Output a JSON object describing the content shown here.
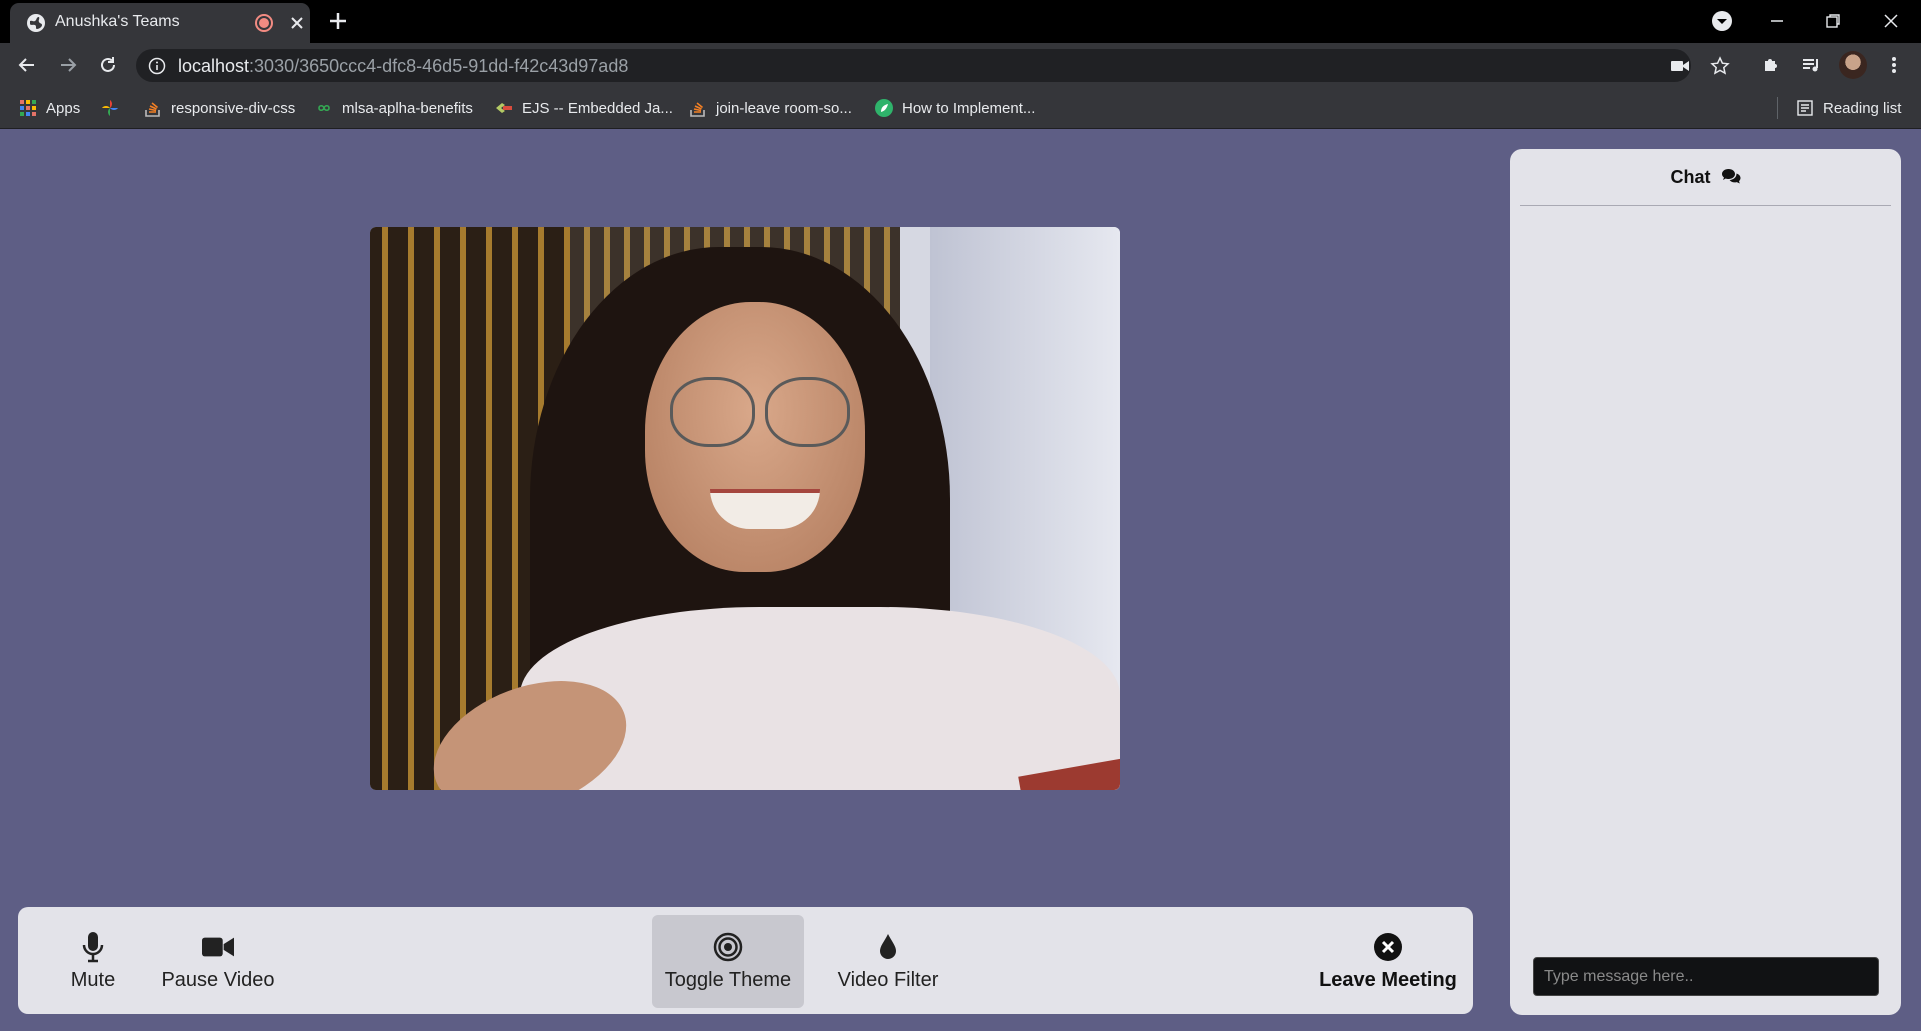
{
  "browser": {
    "tab": {
      "title": "Anushka's Teams"
    },
    "url": {
      "host": "localhost",
      "path": ":3030/3650ccc4-dfc8-46d5-91dd-f42c43d97ad8"
    },
    "bookmarks": [
      {
        "label": "Apps",
        "icon": "apps-grid-icon"
      },
      {
        "label": "",
        "icon": "pinwheel-icon"
      },
      {
        "label": "responsive-div-css",
        "icon": "stackoverflow-icon"
      },
      {
        "label": "mlsa-aplha-benefits",
        "icon": "infinity-icon"
      },
      {
        "label": "EJS -- Embedded Ja...",
        "icon": "ejs-icon"
      },
      {
        "label": "join-leave room-so...",
        "icon": "stackoverflow-icon"
      },
      {
        "label": "How to Implement...",
        "icon": "green-leaf-icon"
      }
    ],
    "reading_list": "Reading list"
  },
  "meeting": {
    "controls": {
      "mute": "Mute",
      "pause_video": "Pause Video",
      "toggle_theme": "Toggle Theme",
      "video_filter": "Video Filter",
      "leave_meeting": "Leave Meeting"
    }
  },
  "chat": {
    "title": "Chat",
    "input_placeholder": "Type message here.."
  },
  "colors": {
    "page_bg": "#5e5e85",
    "panel_bg": "#e3e3e9",
    "active_ctl": "#c8c8cf"
  }
}
